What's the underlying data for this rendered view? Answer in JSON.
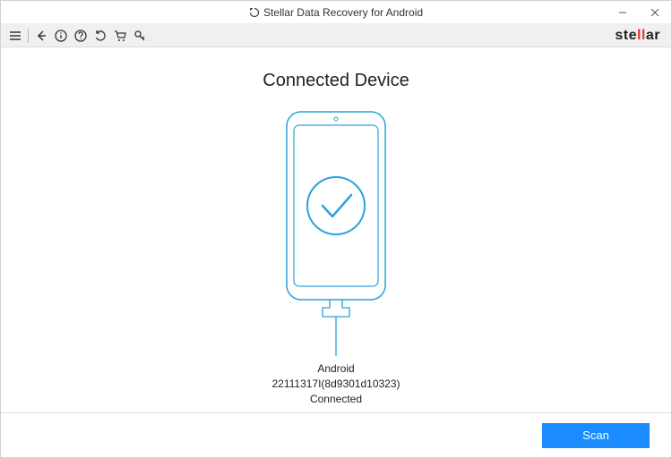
{
  "window": {
    "title": "Stellar Data Recovery for Android"
  },
  "brand": {
    "pre": "ste",
    "mid": "ll",
    "post": "ar"
  },
  "main": {
    "heading": "Connected Device",
    "device_os": "Android",
    "device_id": "22111317I(8d9301d10323)",
    "device_status": "Connected"
  },
  "footer": {
    "scan_label": "Scan"
  },
  "colors": {
    "accent": "#1a8cff",
    "brand_red": "#e23b2e",
    "phone_stroke": "#2aa3d9"
  }
}
